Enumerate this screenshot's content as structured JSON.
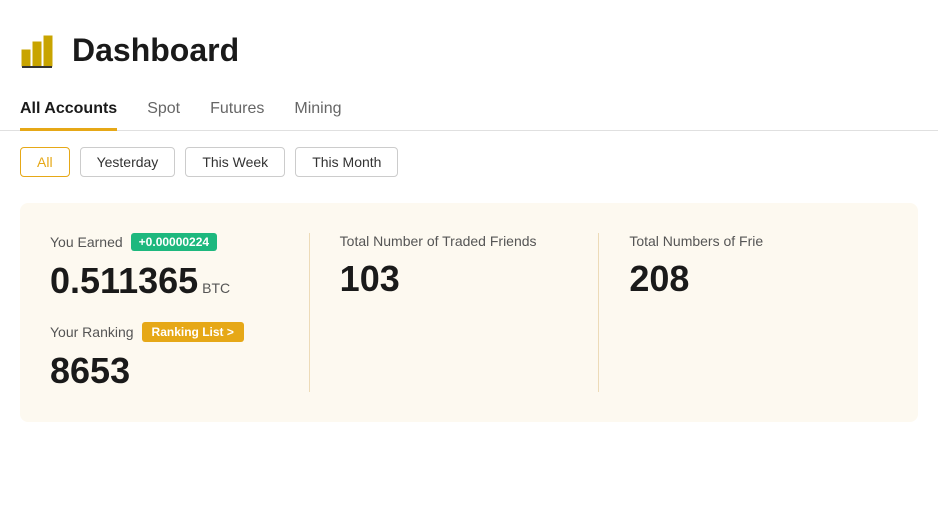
{
  "header": {
    "title": "Dashboard"
  },
  "tabs": {
    "items": [
      {
        "label": "All Accounts",
        "active": true
      },
      {
        "label": "Spot",
        "active": false
      },
      {
        "label": "Futures",
        "active": false
      },
      {
        "label": "Mining",
        "active": false
      }
    ]
  },
  "timeFilters": {
    "items": [
      {
        "label": "All",
        "active": true
      },
      {
        "label": "Yesterday",
        "active": false
      },
      {
        "label": "This Week",
        "active": false
      },
      {
        "label": "This Month",
        "active": false
      }
    ]
  },
  "stats": {
    "earned": {
      "label": "You Earned",
      "badge": "+0.00000224",
      "value": "0.511365",
      "unit": "BTC"
    },
    "tradedFriends": {
      "label": "Total Number of Traded Friends",
      "value": "103"
    },
    "totalFriends": {
      "label": "Total Numbers of Frie",
      "value": "208"
    },
    "ranking": {
      "label": "Your Ranking",
      "listBtn": "Ranking List >",
      "value": "8653"
    }
  }
}
